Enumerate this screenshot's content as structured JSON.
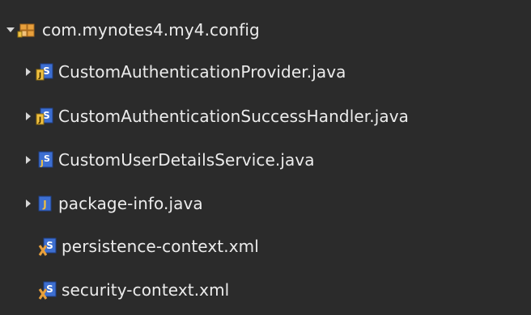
{
  "package": {
    "name": "com.mynotes4.my4.config",
    "icon": "package-folder-icon",
    "expanded": true
  },
  "items": [
    {
      "label": "CustomAuthenticationProvider.java",
      "icon": "java-class-spring-icon",
      "expandable": true
    },
    {
      "label": "CustomAuthenticationSuccessHandler.java",
      "icon": "java-class-spring-icon",
      "expandable": true
    },
    {
      "label": "CustomUserDetailsService.java",
      "icon": "java-class-spring-icon",
      "expandable": true
    },
    {
      "label": "package-info.java",
      "icon": "java-file-icon",
      "expandable": true
    },
    {
      "label": "persistence-context.xml",
      "icon": "spring-xml-icon",
      "expandable": false
    },
    {
      "label": "security-context.xml",
      "icon": "spring-xml-icon",
      "expandable": false
    }
  ],
  "colors": {
    "background": "#2b2b2b",
    "text": "#ececec",
    "arrow": "#d6d6d6"
  }
}
